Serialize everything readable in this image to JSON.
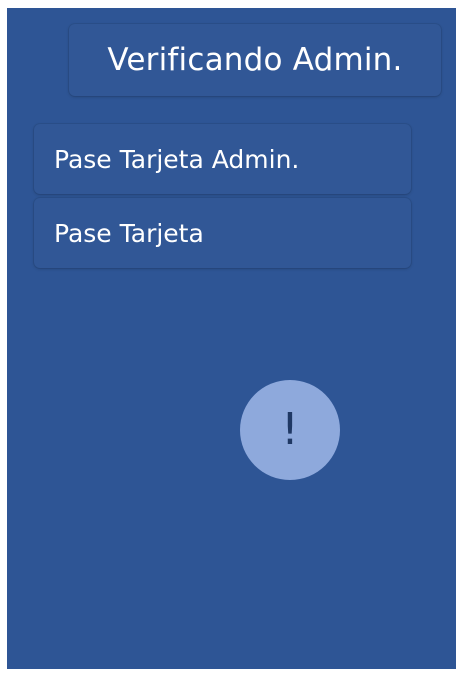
{
  "header": {
    "title": "Verificando Admin."
  },
  "prompts": [
    {
      "label": "Pase Tarjeta Admin."
    },
    {
      "label": "Pase Tarjeta"
    }
  ],
  "alert": {
    "icon": "exclamation-icon",
    "glyph": "!"
  },
  "colors": {
    "background": "#2e5595",
    "alert_circle": "#8ea9dc",
    "alert_glyph": "#1f3864",
    "text": "#ffffff"
  }
}
